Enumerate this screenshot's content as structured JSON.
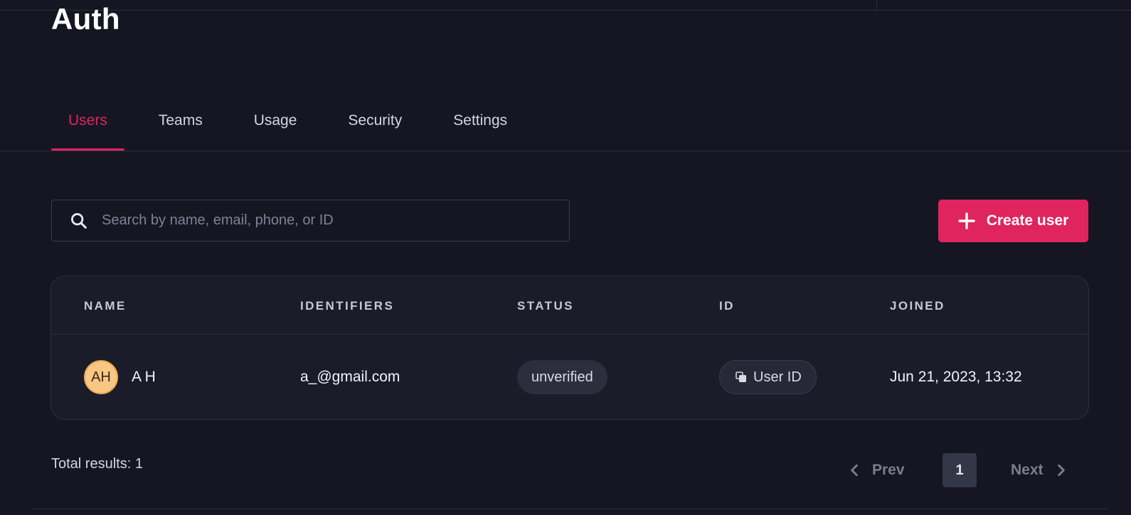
{
  "header": {
    "title": "Auth"
  },
  "tabs": [
    {
      "label": "Users",
      "active": true
    },
    {
      "label": "Teams",
      "active": false
    },
    {
      "label": "Usage",
      "active": false
    },
    {
      "label": "Security",
      "active": false
    },
    {
      "label": "Settings",
      "active": false
    }
  ],
  "search": {
    "placeholder": "Search by name, email, phone, or ID",
    "value": "",
    "icon": "search-icon"
  },
  "create_button": {
    "label": "Create user",
    "icon": "plus-icon"
  },
  "table": {
    "columns": [
      "NAME",
      "IDENTIFIERS",
      "STATUS",
      "ID",
      "JOINED"
    ],
    "rows": [
      {
        "avatar_initials": "AH",
        "name": "A H",
        "identifier": "a_@gmail.com",
        "status": "unverified",
        "id_label": "User ID",
        "joined": "Jun 21, 2023, 13:32"
      }
    ]
  },
  "footer": {
    "total": "Total results: 1",
    "prev_label": "Prev",
    "next_label": "Next",
    "current_page": "1"
  },
  "colors": {
    "background": "#151622",
    "accent": "#e0245e",
    "card": "#1b1c29",
    "avatar": "#f9c784"
  }
}
